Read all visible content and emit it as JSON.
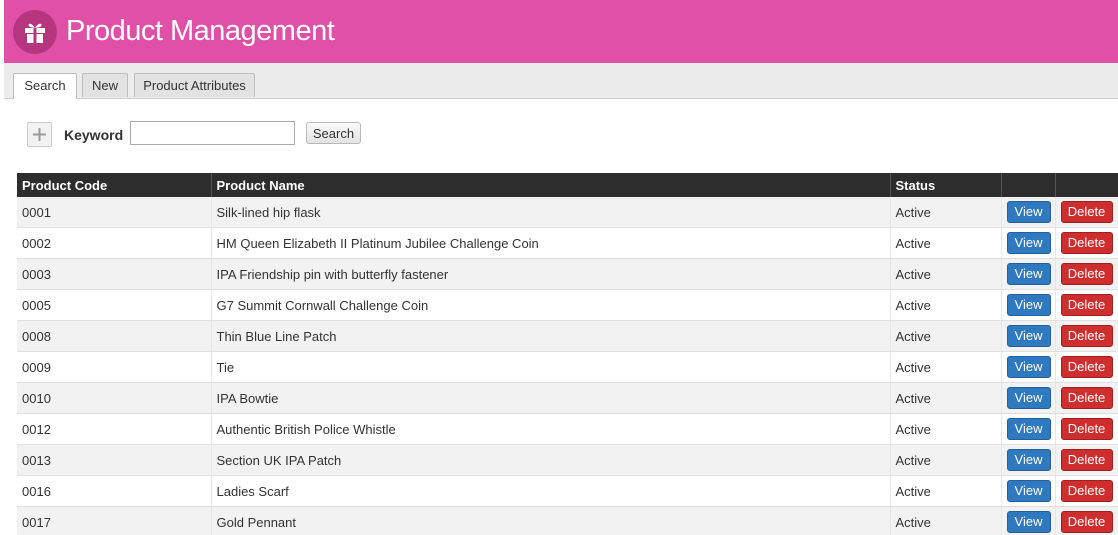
{
  "header": {
    "title": "Product Management",
    "logo_icon": "gift-icon",
    "bg_color": "#e050a6"
  },
  "tabs": [
    {
      "label": "Search",
      "active": true
    },
    {
      "label": "New",
      "active": false
    },
    {
      "label": "Product Attributes",
      "active": false
    }
  ],
  "search": {
    "keyword_label": "Keyword",
    "keyword_value": "",
    "button_label": "Search",
    "add_icon": "plus-icon"
  },
  "table": {
    "columns": [
      "Product Code",
      "Product Name",
      "Status",
      "",
      ""
    ],
    "view_label": "View",
    "delete_label": "Delete",
    "rows": [
      {
        "code": "0001",
        "name": "Silk-lined hip flask",
        "status": "Active"
      },
      {
        "code": "0002",
        "name": "HM Queen Elizabeth II Platinum Jubilee Challenge Coin",
        "status": "Active"
      },
      {
        "code": "0003",
        "name": "IPA Friendship pin with butterfly fastener",
        "status": "Active"
      },
      {
        "code": "0005",
        "name": "G7 Summit Cornwall Challenge Coin",
        "status": "Active"
      },
      {
        "code": "0008",
        "name": "Thin Blue Line Patch",
        "status": "Active"
      },
      {
        "code": "0009",
        "name": "Tie",
        "status": "Active"
      },
      {
        "code": "0010",
        "name": "IPA Bowtie",
        "status": "Active"
      },
      {
        "code": "0012",
        "name": "Authentic British Police Whistle",
        "status": "Active"
      },
      {
        "code": "0013",
        "name": "Section UK IPA Patch",
        "status": "Active"
      },
      {
        "code": "0016",
        "name": "Ladies Scarf",
        "status": "Active"
      },
      {
        "code": "0017",
        "name": "Gold Pennant",
        "status": "Active"
      }
    ]
  }
}
